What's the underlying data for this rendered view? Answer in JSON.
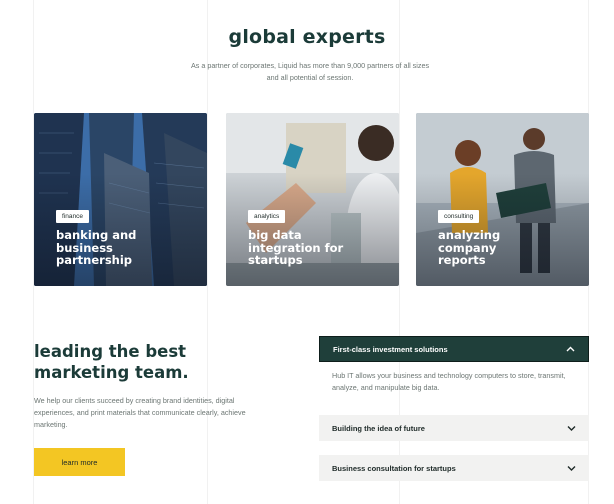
{
  "header": {
    "title": "global experts",
    "subtitle_line1": "As a partner of corporates, Liquid has more than 9,000 partners of all sizes",
    "subtitle_line2": "and all potential of session."
  },
  "cards": [
    {
      "tag": "finance",
      "title_lines": [
        "banking and",
        "business",
        "partnership"
      ]
    },
    {
      "tag": "analytics",
      "title_lines": [
        "big data",
        "integration for",
        "startups"
      ]
    },
    {
      "tag": "consulting",
      "title_lines": [
        "analyzing",
        "company",
        "reports"
      ]
    }
  ],
  "lead": {
    "title_line1": "leading the best",
    "title_line2": "marketing team.",
    "body": "We help our clients succeed by creating brand identities, digital experiences, and print materials that communicate clearly, achieve marketing.",
    "button_label": "learn more"
  },
  "accordion": [
    {
      "label": "First-class investment solutions",
      "open": true,
      "body": "Hub IT allows your business and technology computers to store, transmit, analyze, and manipulate big data."
    },
    {
      "label": "Building the idea of future",
      "open": false
    },
    {
      "label": "Business consultation for startups",
      "open": false
    }
  ],
  "colors": {
    "brand_dark": "#1f3f3a",
    "accent_yellow": "#f3c623",
    "panel_gray": "#f2f2f1"
  }
}
